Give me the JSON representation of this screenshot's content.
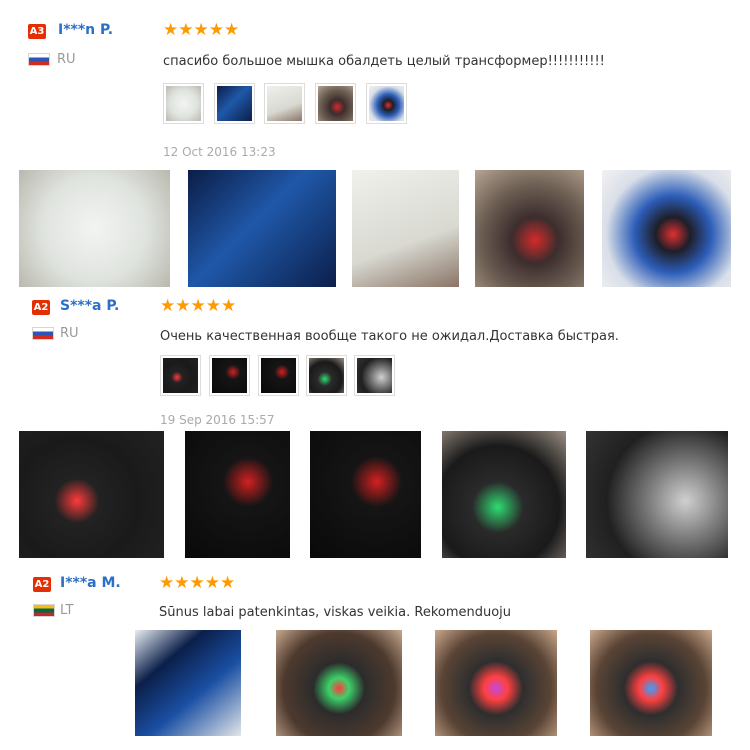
{
  "reviews": [
    {
      "level_badge": "A3",
      "name": "I***n P.",
      "country": "RU",
      "stars": "★★★★★",
      "comment": "спасибо большое мышка обалдеть целый трансформер!!!!!!!!!!!",
      "date": "12 Oct 2016 13:23"
    },
    {
      "level_badge": "A2",
      "name": "S***a P.",
      "country": "RU",
      "stars": "★★★★★",
      "comment": "Очень качественная вообще такого не ожидал.Доставка быстрая.",
      "date": "19 Sep 2016 15:57"
    },
    {
      "level_badge": "A2",
      "name": "I***a M.",
      "country": "LT",
      "stars": "★★★★★",
      "comment": "Sūnus labai patenkintas, viskas veikia. Rekomenduoju",
      "date": ""
    }
  ]
}
